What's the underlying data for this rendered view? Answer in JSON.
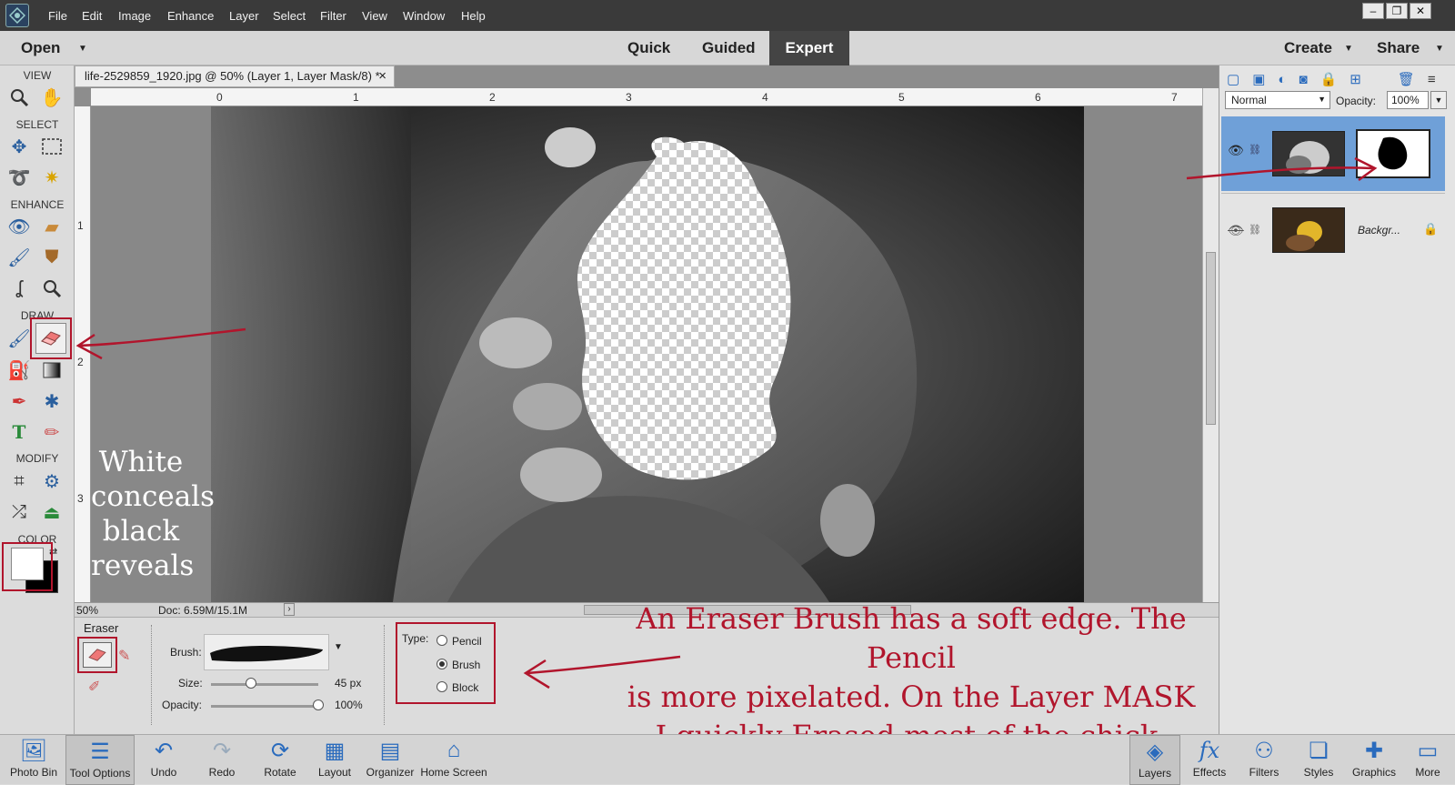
{
  "menubar": {
    "items": [
      "File",
      "Edit",
      "Image",
      "Enhance",
      "Layer",
      "Select",
      "Filter",
      "View",
      "Window",
      "Help"
    ],
    "window_buttons": [
      "–",
      "❐",
      "✕"
    ]
  },
  "modebar": {
    "open": "Open",
    "modes": [
      "Quick",
      "Guided",
      "Expert"
    ],
    "active_mode": "Expert",
    "create": "Create",
    "share": "Share"
  },
  "document": {
    "tab_title": "life-2529859_1920.jpg @ 50% (Layer 1, Layer Mask/8) *",
    "close": "×",
    "ruler_h": [
      "0",
      "1",
      "2",
      "3",
      "4",
      "5",
      "6",
      "7"
    ],
    "ruler_v": [
      "1",
      "2",
      "3"
    ],
    "zoom": "50%",
    "doc_size": "Doc: 6.59M/15.1M"
  },
  "toolbox": {
    "sections": {
      "view": "VIEW",
      "select": "SELECT",
      "enhance": "ENHANCE",
      "draw": "DRAW",
      "modify": "MODIFY",
      "color": "COLOR"
    }
  },
  "options": {
    "tool_name": "Eraser",
    "brush_label": "Brush:",
    "size_label": "Size:",
    "size_value": "45 px",
    "size_fraction": 0.37,
    "opacity_label": "Opacity:",
    "opacity_value": "100%",
    "opacity_fraction": 1.0,
    "type_label": "Type:",
    "types": [
      "Pencil",
      "Brush",
      "Block"
    ],
    "selected_type": "Brush"
  },
  "layers_panel": {
    "blend_mode": "Normal",
    "opacity_label": "Opacity:",
    "opacity_value": "100%",
    "background_name": "Backgr..."
  },
  "annotations": {
    "left_lines": [
      "White",
      "conceals",
      "black",
      "reveals"
    ],
    "bottom_lines": [
      "An Eraser Brush has a soft edge. The Pencil",
      "is more pixelated. On the Layer MASK",
      "I quickly Erased most of the chick."
    ]
  },
  "bottombar": {
    "left": [
      {
        "label": "Photo Bin",
        "icon": "photo-bin-icon"
      },
      {
        "label": "Tool Options",
        "icon": "tool-options-icon"
      },
      {
        "label": "Undo",
        "icon": "undo-icon"
      },
      {
        "label": "Redo",
        "icon": "redo-icon"
      },
      {
        "label": "Rotate",
        "icon": "rotate-icon"
      },
      {
        "label": "Layout",
        "icon": "layout-icon"
      },
      {
        "label": "Organizer",
        "icon": "organizer-icon"
      },
      {
        "label": "Home Screen",
        "icon": "home-icon"
      }
    ],
    "right": [
      {
        "label": "Layers",
        "icon": "layers-icon"
      },
      {
        "label": "Effects",
        "icon": "effects-icon"
      },
      {
        "label": "Filters",
        "icon": "filters-icon"
      },
      {
        "label": "Styles",
        "icon": "styles-icon"
      },
      {
        "label": "Graphics",
        "icon": "graphics-icon"
      },
      {
        "label": "More",
        "icon": "more-icon"
      }
    ]
  },
  "colors": {
    "annotation": "#b1152c",
    "accent": "#2a6bbd",
    "selected_layer": "#6fa0d8"
  }
}
